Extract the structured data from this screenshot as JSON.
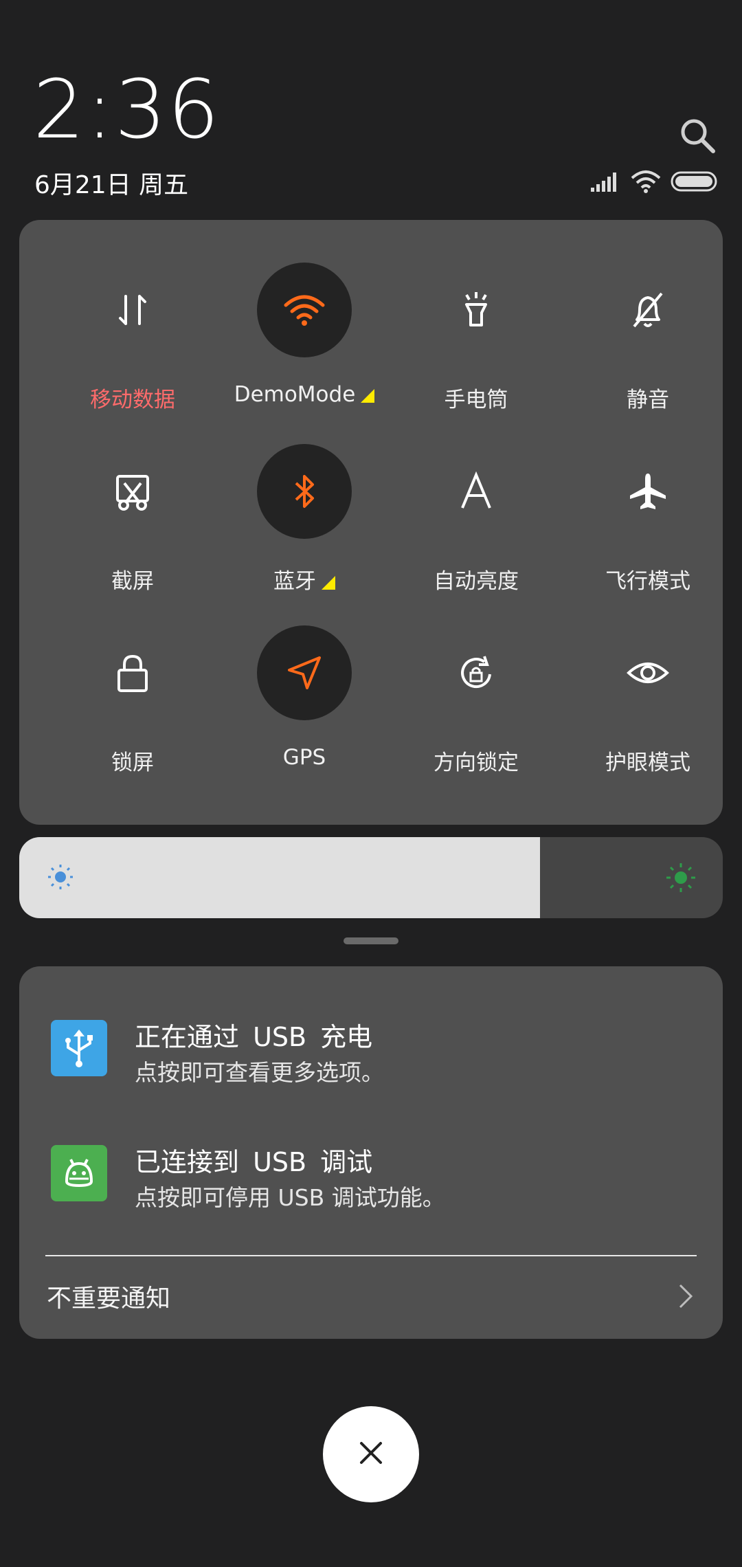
{
  "header": {
    "time": "2:36",
    "date": "6月21日 周五",
    "search_icon": "search-icon",
    "status_icons": [
      "signal-icon",
      "wifi-icon",
      "battery-icon"
    ]
  },
  "quick_settings": {
    "tiles": [
      {
        "label": "移动数据",
        "icon": "mobile-data-icon",
        "active": false,
        "label_color": "#ff6b6b"
      },
      {
        "label": "DemoMode",
        "icon": "wifi-icon",
        "active": true,
        "has_more": true
      },
      {
        "label": "手电筒",
        "icon": "flashlight-icon",
        "active": false
      },
      {
        "label": "静音",
        "icon": "mute-bell-icon",
        "active": false
      },
      {
        "label": "截屏",
        "icon": "screenshot-icon",
        "active": false
      },
      {
        "label": "蓝牙",
        "icon": "bluetooth-icon",
        "active": true,
        "has_more": true
      },
      {
        "label": "自动亮度",
        "icon": "auto-brightness-icon",
        "active": false
      },
      {
        "label": "飞行模式",
        "icon": "airplane-icon",
        "active": false
      },
      {
        "label": "锁屏",
        "icon": "lock-icon",
        "active": false
      },
      {
        "label": "GPS",
        "icon": "location-arrow-icon",
        "active": true
      },
      {
        "label": "方向锁定",
        "icon": "rotation-lock-icon",
        "active": false
      },
      {
        "label": "护眼模式",
        "icon": "eye-icon",
        "active": false
      }
    ],
    "active_color": "#ff6a1a"
  },
  "brightness": {
    "level": 0.74,
    "low_icon": "sun-low-icon",
    "high_icon": "sun-high-icon"
  },
  "notifications": {
    "items": [
      {
        "title": "正在通过 USB 充电",
        "text": "点按即可查看更多选项。",
        "icon": "usb-icon",
        "icon_color": "#3ea5e6"
      },
      {
        "title": "已连接到 USB 调试",
        "text": "点按即可停用 USB 调试功能。",
        "icon": "android-icon",
        "icon_color": "#4caf50"
      }
    ],
    "unimportant_label": "不重要通知"
  },
  "close_icon": "close-icon"
}
